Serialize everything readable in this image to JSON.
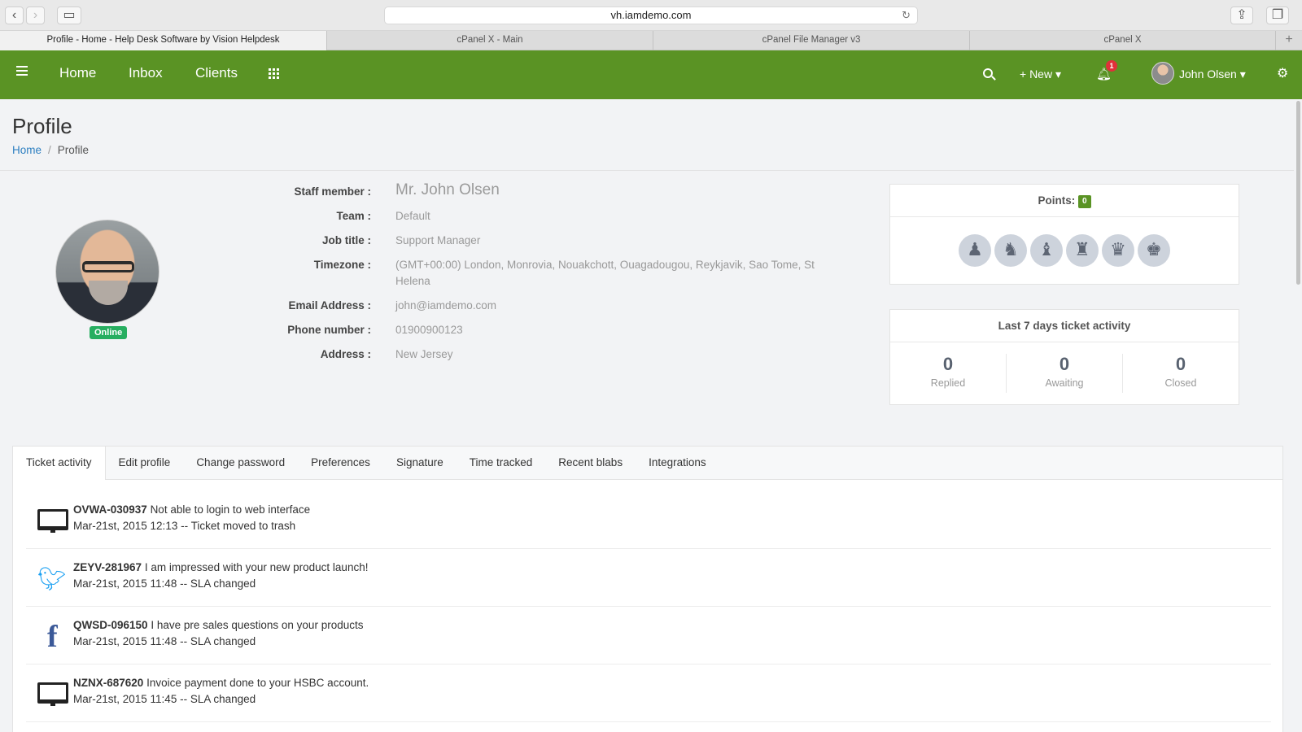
{
  "browser": {
    "url": "vh.iamdemo.com",
    "tabs": [
      {
        "label": "Profile - Home - Help Desk Software by Vision Helpdesk",
        "active": true
      },
      {
        "label": "cPanel X - Main",
        "active": false
      },
      {
        "label": "cPanel File Manager v3",
        "active": false
      },
      {
        "label": "cPanel X",
        "active": false
      }
    ]
  },
  "header": {
    "nav": [
      "Home",
      "Inbox",
      "Clients"
    ],
    "new_label": "+ New ▾",
    "notification_count": "1",
    "user_name": "John Olsen ▾",
    "brand_color": "#5a9324"
  },
  "page": {
    "title": "Profile",
    "breadcrumb": [
      "Home",
      "/",
      "Profile"
    ]
  },
  "profile": {
    "status": "Online",
    "fields": [
      {
        "label": "Staff member :",
        "value": "Mr. John Olsen"
      },
      {
        "label": "Team :",
        "value": "Default"
      },
      {
        "label": "Job title :",
        "value": "Support Manager"
      },
      {
        "label": "Timezone :",
        "value": "(GMT+00:00) London, Monrovia, Nouakchott, Ouagadougou, Reykjavik, Sao Tome, St Helena"
      },
      {
        "label": "Email Address :",
        "value": "john@iamdemo.com"
      },
      {
        "label": "Phone number :",
        "value": "01900900123"
      },
      {
        "label": "Address :",
        "value": "New Jersey"
      }
    ]
  },
  "points": {
    "label": "Points:",
    "value": "0",
    "badges": [
      "pawn-icon",
      "knight-icon",
      "bishop-icon",
      "rook-icon",
      "queen-icon",
      "king-icon"
    ]
  },
  "activity_summary": {
    "title": "Last 7 days ticket activity",
    "stats": [
      {
        "value": "0",
        "label": "Replied"
      },
      {
        "value": "0",
        "label": "Awaiting"
      },
      {
        "value": "0",
        "label": "Closed"
      }
    ]
  },
  "profile_tabs": [
    "Ticket activity",
    "Edit profile",
    "Change password",
    "Preferences",
    "Signature",
    "Time tracked",
    "Recent blabs",
    "Integrations"
  ],
  "tickets": [
    {
      "icon": "monitor-icon",
      "id": "OVWA-030937",
      "subject": "Not able to login to web interface",
      "detail": "Mar-21st, 2015 12:13 -- Ticket moved to trash"
    },
    {
      "icon": "twitter-icon",
      "id": "ZEYV-281967",
      "subject": "I am impressed with your new product launch!",
      "detail": "Mar-21st, 2015 11:48 -- SLA changed"
    },
    {
      "icon": "facebook-icon",
      "id": "QWSD-096150",
      "subject": "I have pre sales questions on your products",
      "detail": "Mar-21st, 2015 11:48 -- SLA changed"
    },
    {
      "icon": "monitor-icon",
      "id": "NZNX-687620",
      "subject": "Invoice payment done to your HSBC account.",
      "detail": "Mar-21st, 2015 11:45 -- SLA changed"
    }
  ]
}
